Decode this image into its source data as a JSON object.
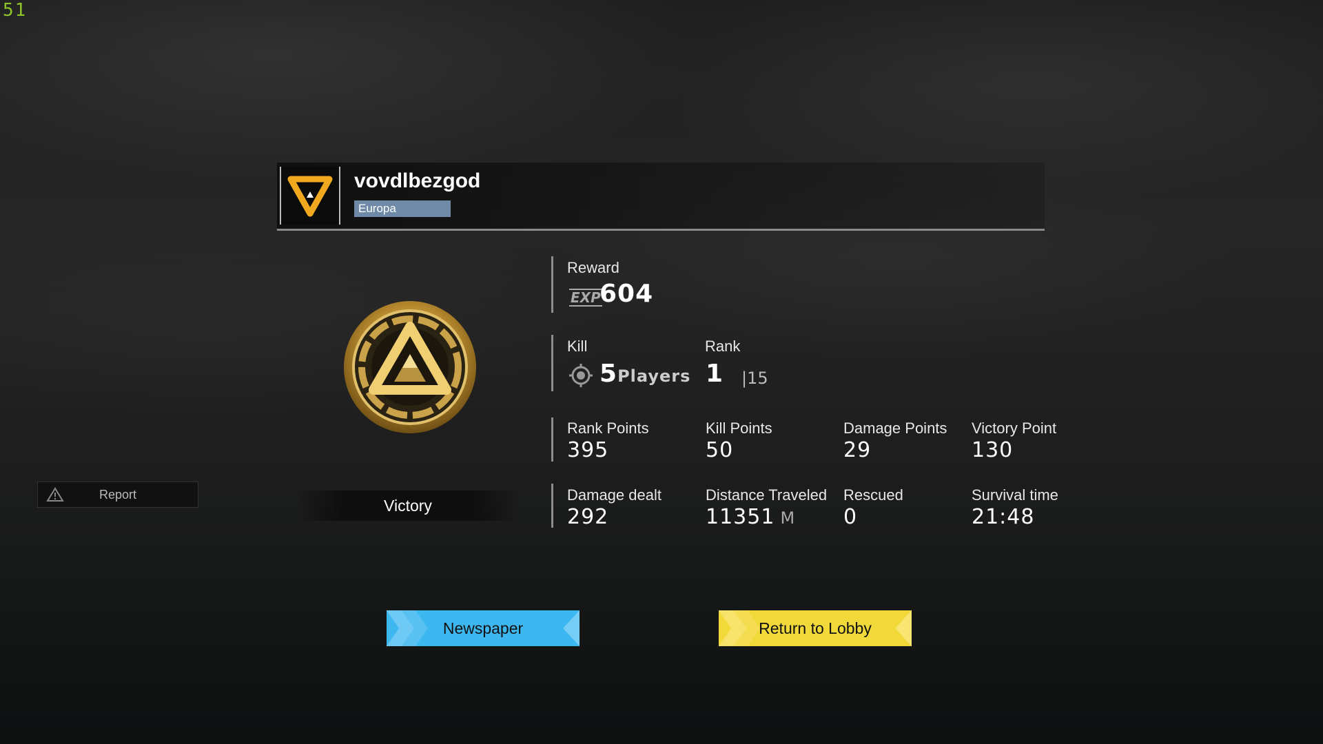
{
  "hud": {
    "fps": "51"
  },
  "player": {
    "name": "vovdlbezgod",
    "region": "Europa"
  },
  "result": {
    "label": "Victory"
  },
  "report": {
    "label": "Report"
  },
  "reward": {
    "label": "Reward",
    "currency": "EXP",
    "value": "604"
  },
  "kill": {
    "label": "Kill",
    "value": "5",
    "unit": "Players"
  },
  "rank": {
    "label": "Rank",
    "value": "1",
    "total": "|15"
  },
  "points": {
    "rank_points": {
      "label": "Rank Points",
      "value": "395"
    },
    "kill_points": {
      "label": "Kill Points",
      "value": "50"
    },
    "damage_points": {
      "label": "Damage Points",
      "value": "29"
    },
    "victory_point": {
      "label": "Victory Point",
      "value": "130"
    }
  },
  "stats": {
    "damage_dealt": {
      "label": "Damage dealt",
      "value": "292"
    },
    "distance": {
      "label": "Distance Traveled",
      "value": "11351",
      "unit": "M"
    },
    "rescued": {
      "label": "Rescued",
      "value": "0"
    },
    "survival": {
      "label": "Survival time",
      "value": "21:48"
    }
  },
  "buttons": {
    "newspaper": "Newspaper",
    "lobby": "Return to Lobby"
  },
  "colors": {
    "newspaper": "#3db7f0",
    "lobby": "#f2d93a",
    "badge": "#6f8aa6",
    "fps": "#8ec32a",
    "medal_gold": "#d9b24a"
  }
}
